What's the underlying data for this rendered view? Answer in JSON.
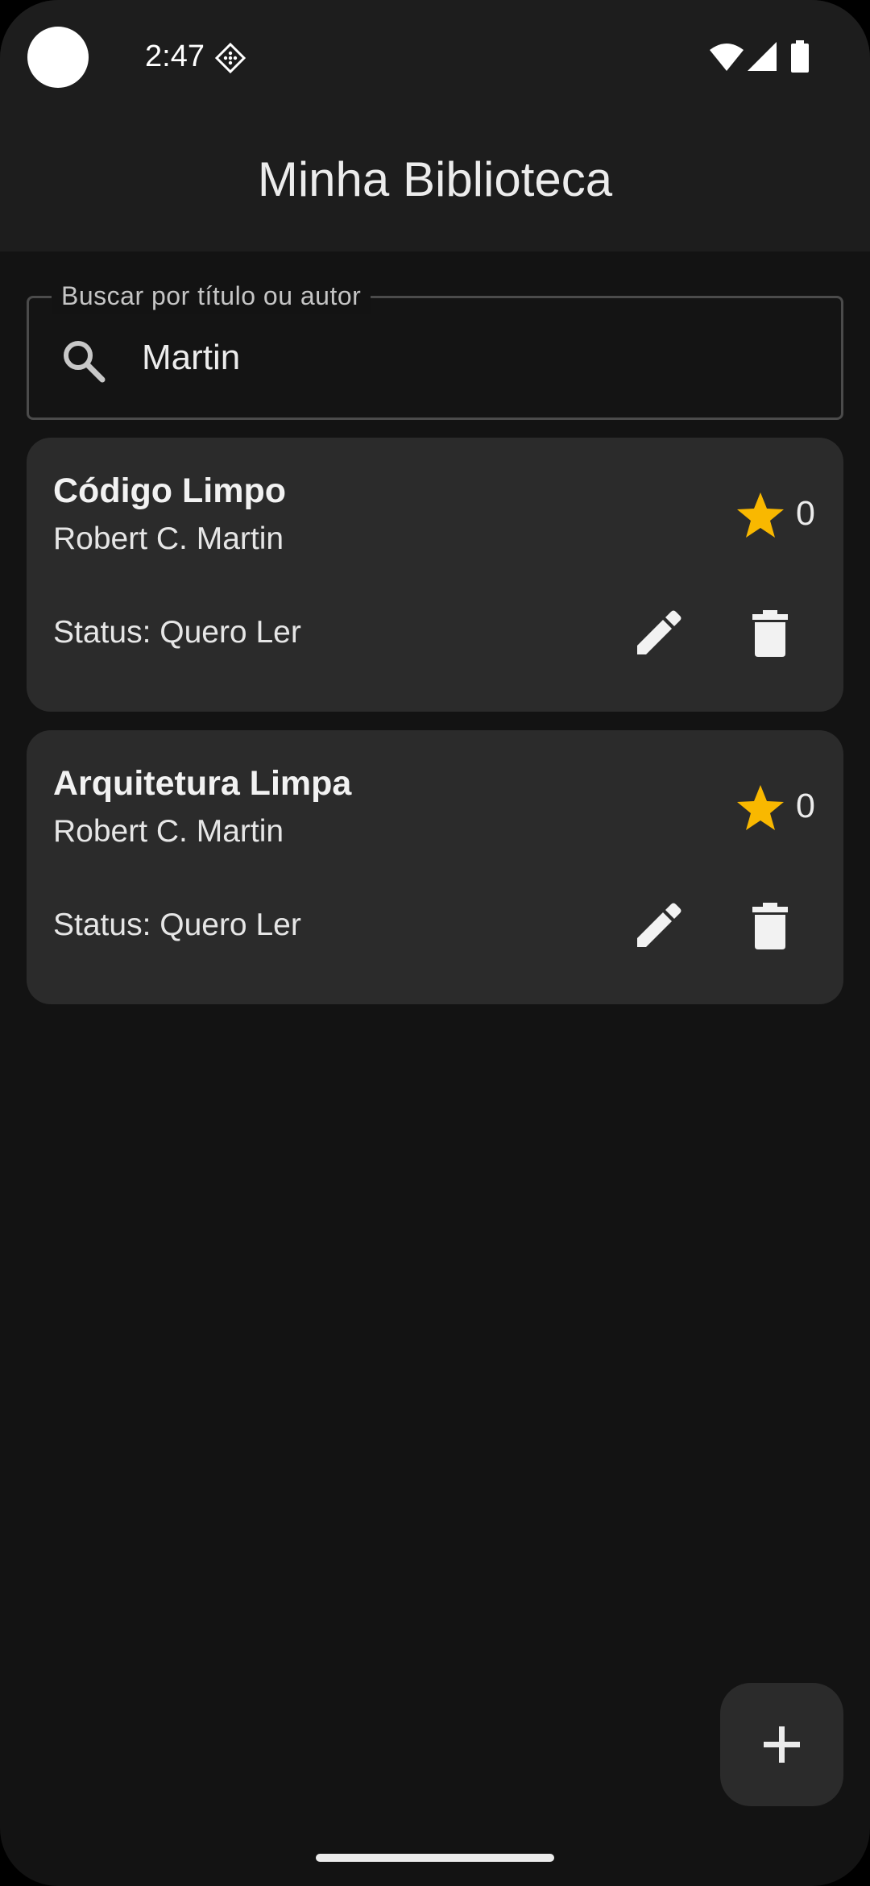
{
  "status_bar": {
    "time": "2:47"
  },
  "app_bar": {
    "title": "Minha Biblioteca"
  },
  "search": {
    "label": "Buscar por título ou autor",
    "value": "Martin"
  },
  "books": [
    {
      "title": "Código Limpo",
      "author": "Robert C. Martin",
      "status": "Status: Quero Ler",
      "rating": "0"
    },
    {
      "title": "Arquitetura Limpa",
      "author": "Robert C. Martin",
      "status": "Status: Quero Ler",
      "rating": "0"
    }
  ],
  "icons": {
    "search": "search-icon",
    "star": "star-icon",
    "edit": "edit-icon",
    "delete": "delete-icon",
    "add": "add-icon"
  },
  "colors": {
    "background": "#131313",
    "surface": "#2b2b2b",
    "app_bar": "#1d1d1d",
    "star": "#f9b800",
    "text": "#ececec"
  }
}
